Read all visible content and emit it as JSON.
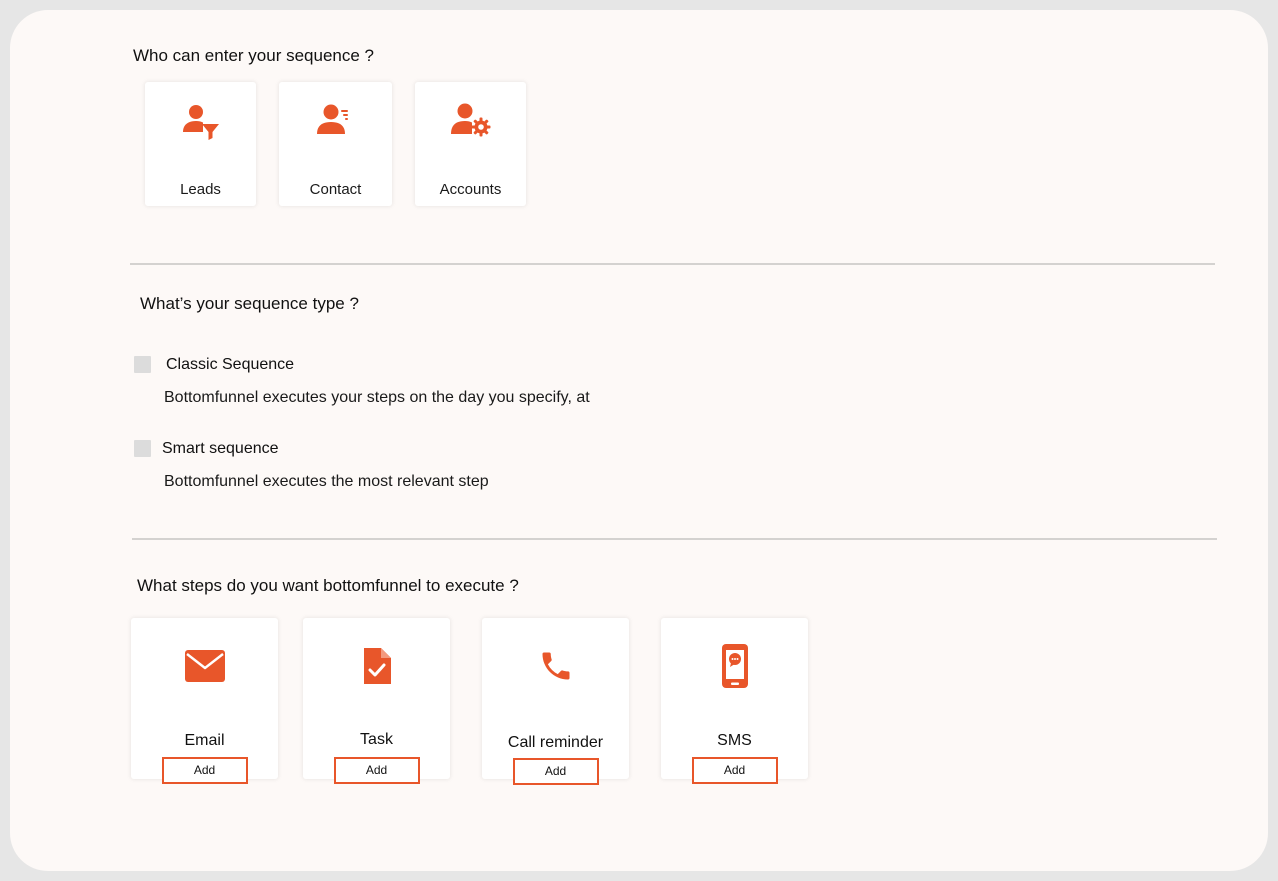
{
  "colors": {
    "accent": "#e8562a",
    "background": "#fdf9f7",
    "checkbox": "#dcdcdc"
  },
  "entry": {
    "heading": "Who can enter your sequence ?",
    "options": [
      {
        "label": "Leads",
        "icon": "user-filter-icon"
      },
      {
        "label": "Contact",
        "icon": "user-list-icon"
      },
      {
        "label": "Accounts",
        "icon": "user-gear-icon"
      }
    ]
  },
  "sequence_type": {
    "heading": "What’s your sequence type ?",
    "options": [
      {
        "title": "Classic Sequence",
        "description": "Bottomfunnel executes your steps on the day you specify, at",
        "checked": false
      },
      {
        "title": "Smart sequence",
        "description": "Bottomfunnel executes the most relevant step",
        "checked": false
      }
    ]
  },
  "steps": {
    "heading": "What steps do you want bottomfunnel to execute ?",
    "items": [
      {
        "label": "Email",
        "icon": "envelope-icon",
        "button": "Add"
      },
      {
        "label": "Task",
        "icon": "task-document-icon",
        "button": "Add"
      },
      {
        "label": "Call reminder",
        "icon": "phone-icon",
        "button": "Add"
      },
      {
        "label": "SMS",
        "icon": "mobile-sms-icon",
        "button": "Add"
      }
    ]
  }
}
